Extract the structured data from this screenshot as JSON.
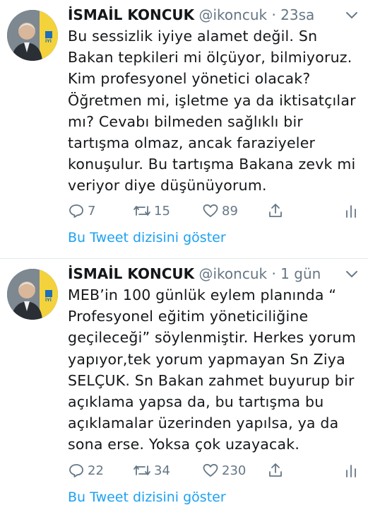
{
  "tweets": [
    {
      "name": "İSMAİL KONCUK",
      "handle": "@ikoncuk",
      "separator": "·",
      "time": "23sa",
      "text": "Bu sessizlik iyiye alamet değil. Sn Bakan tepkileri mi ölçüyor, bilmiyoruz. Kim profesyonel yönetici olacak? Öğretmen mi, işletme ya da iktisatçılar mı? Cevabı bilmeden sağlıklı bir tartışma olmaz, ancak faraziyeler konuşulur. Bu tartışma Bakana zevk mi veriyor diye düşünüyorum.",
      "replies": "7",
      "retweets": "15",
      "likes": "89",
      "thread_link": "Bu Tweet dizisini göster"
    },
    {
      "name": "İSMAİL KONCUK",
      "handle": "@ikoncuk",
      "separator": "·",
      "time": "1 gün",
      "text": "MEB’in 100 günlük eylem planında “ Profesyonel eğitim yöneticiliğine geçileceği” söylenmiştir. Herkes yorum yapıyor,tek yorum yapmayan Sn Ziya SELÇUK. Sn Bakan zahmet buyurup bir açıklama yapsa da, bu tartışma bu açıklamalar üzerinden yapılsa, ya da sona erse. Yoksa çok uzayacak.",
      "replies": "22",
      "retweets": "34",
      "likes": "230",
      "thread_link": "Bu Tweet dizisini göster"
    }
  ],
  "avatar_badge": "İYİ",
  "icons": {
    "reply": "reply-icon",
    "retweet": "retweet-icon",
    "like": "heart-icon",
    "share": "share-icon",
    "analytics": "analytics-icon",
    "more": "chevron-down-icon"
  },
  "colors": {
    "link": "#1da1f2",
    "muted": "#657786",
    "text": "#14171a",
    "divider": "#e1e8ed",
    "party_yellow": "#f4d23c"
  }
}
